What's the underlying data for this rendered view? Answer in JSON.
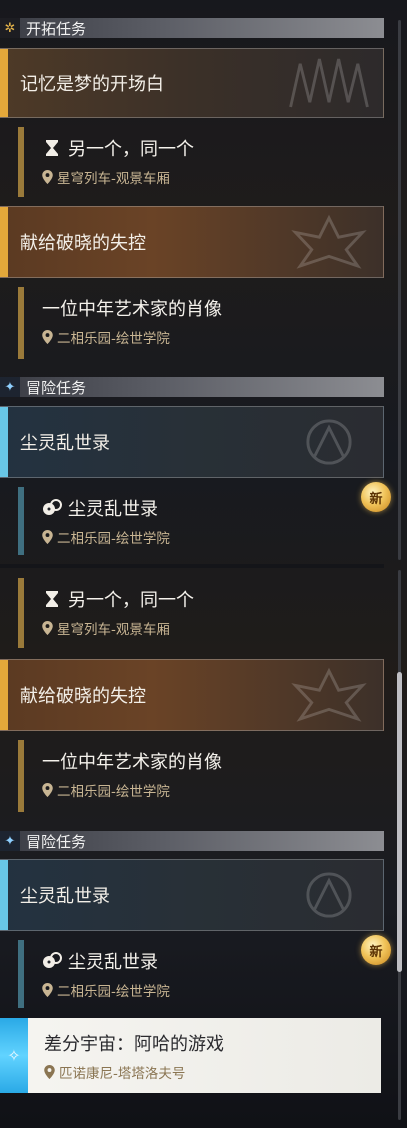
{
  "sections": {
    "trailblaze": "开拓任务",
    "adventure": "冒险任务"
  },
  "missions": {
    "memory": "记忆是梦的开场白",
    "one_same": "另一个，同一个",
    "one_same_loc": "星穹列车-观景车厢",
    "dawn": "献给破晓的失控",
    "portrait": "一位中年艺术家的肖像",
    "portrait_loc": "二相乐园-绘世学院",
    "dust": "尘灵乱世录",
    "dust_sub": "尘灵乱世录",
    "dust_loc": "二相乐园-绘世学院",
    "diff": "差分宇宙：阿哈的游戏",
    "diff_loc": "匹诺康尼-塔塔洛夫号"
  },
  "badge": "新",
  "colors": {
    "gold_accent": "#e4a83a",
    "blue_accent": "#68c6e6",
    "location_text": "#c8b593"
  },
  "icons": [
    "hourglass-icon",
    "dice-icon",
    "location-pin-icon",
    "trailblaze-section-icon",
    "adventure-section-icon",
    "emblem-icon"
  ]
}
